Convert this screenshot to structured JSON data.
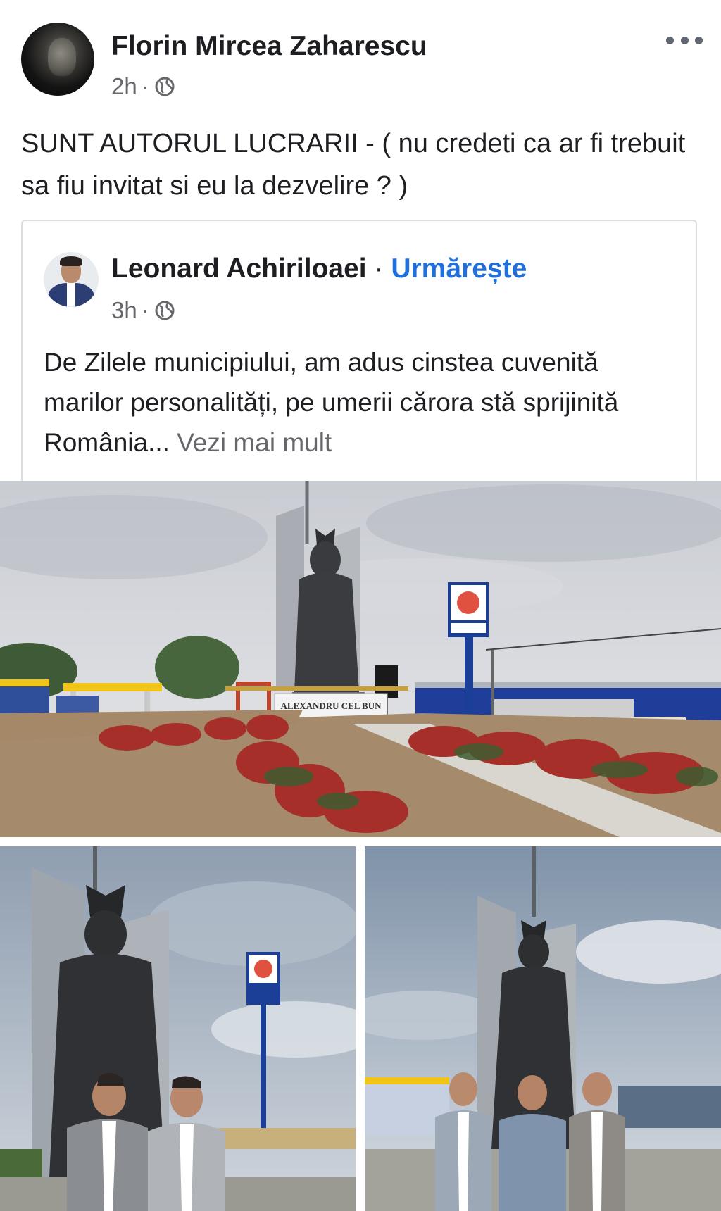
{
  "post": {
    "author": "Florin Mircea Zaharescu",
    "time": "2h",
    "dot": "·",
    "text": "SUNT AUTORUL LUCRARII - ( nu credeti ca ar fi trebuit sa fiu invitat si eu la dezvelire ? )"
  },
  "shared_post": {
    "author": "Leonard Achiriloaei",
    "separator": "·",
    "follow_label": "Urmărește",
    "time": "3h",
    "dot": "·",
    "text": "De Zilele municipiului, am adus cinstea cuvenită marilor personalități, pe umerii cărora stă sprijinită România...",
    "see_more": "Vezi mai mult"
  },
  "photos": {
    "statue_plinth_text": "ALEXANDRU CEL BUN"
  },
  "icons": {
    "more": "more-options-icon",
    "audience": "globe-icon"
  },
  "colors": {
    "link": "#216fdb",
    "meta": "#65676b",
    "text": "#1c1e21"
  }
}
